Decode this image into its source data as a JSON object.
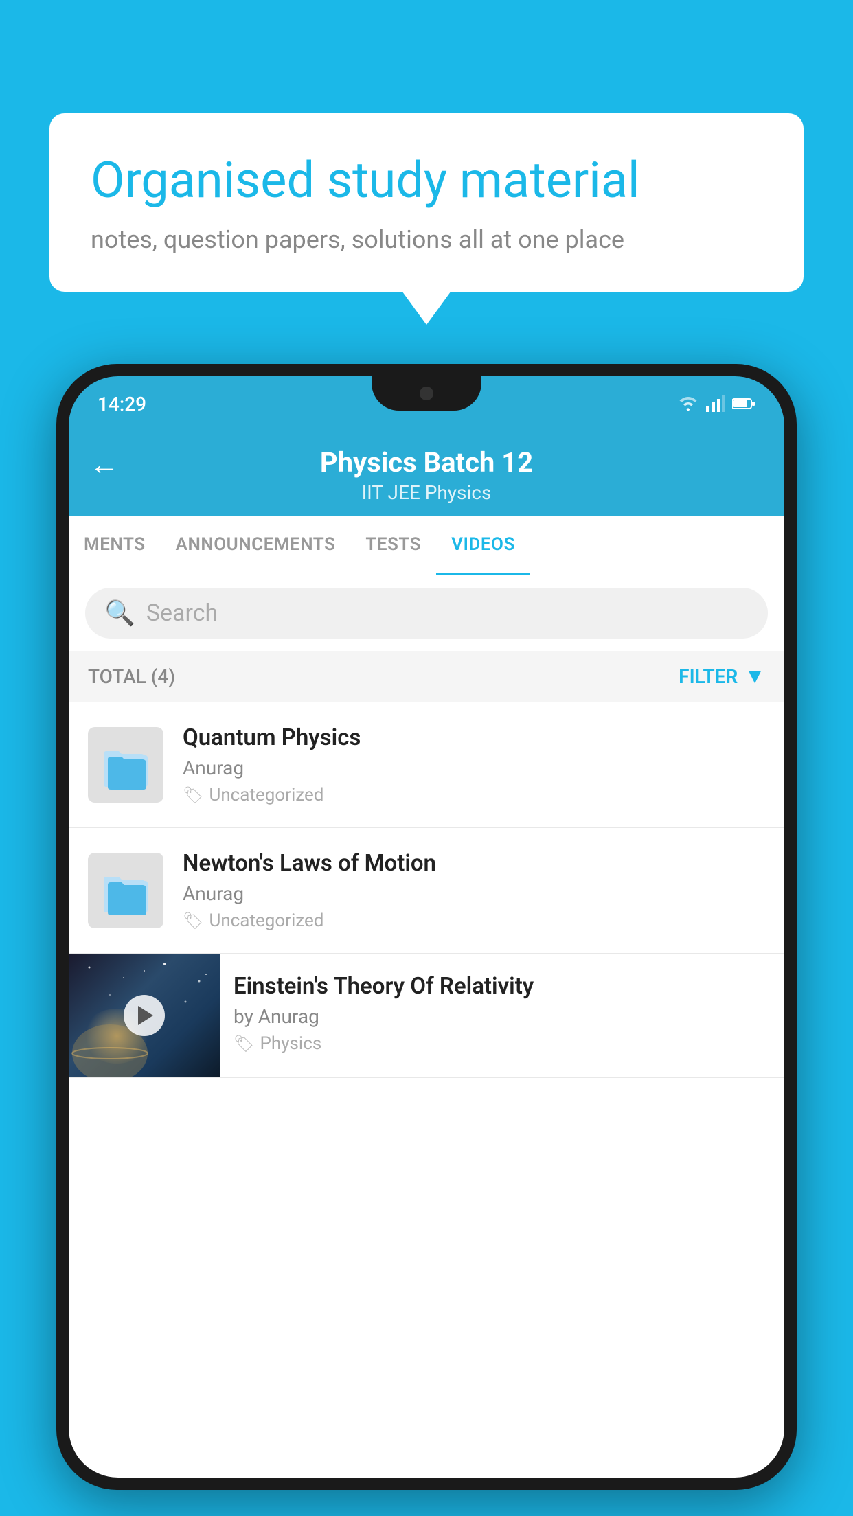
{
  "background": {
    "color": "#1bb8e8"
  },
  "hero": {
    "title": "Organised study material",
    "subtitle": "notes, question papers, solutions all at one place"
  },
  "phone": {
    "status_bar": {
      "time": "14:29"
    },
    "app_header": {
      "back_label": "←",
      "title": "Physics Batch 12",
      "subtitle": "IIT JEE   Physics"
    },
    "tabs": [
      {
        "label": "MENTS",
        "active": false
      },
      {
        "label": "ANNOUNCEMENTS",
        "active": false
      },
      {
        "label": "TESTS",
        "active": false
      },
      {
        "label": "VIDEOS",
        "active": true
      }
    ],
    "search": {
      "placeholder": "Search"
    },
    "filter_bar": {
      "total_label": "TOTAL (4)",
      "filter_label": "FILTER"
    },
    "videos": [
      {
        "id": 1,
        "title": "Quantum Physics",
        "author": "Anurag",
        "tag": "Uncategorized",
        "has_thumb": false
      },
      {
        "id": 2,
        "title": "Newton's Laws of Motion",
        "author": "Anurag",
        "tag": "Uncategorized",
        "has_thumb": false
      },
      {
        "id": 3,
        "title": "Einstein's Theory Of Relativity",
        "author": "by Anurag",
        "tag": "Physics",
        "has_thumb": true
      }
    ]
  }
}
